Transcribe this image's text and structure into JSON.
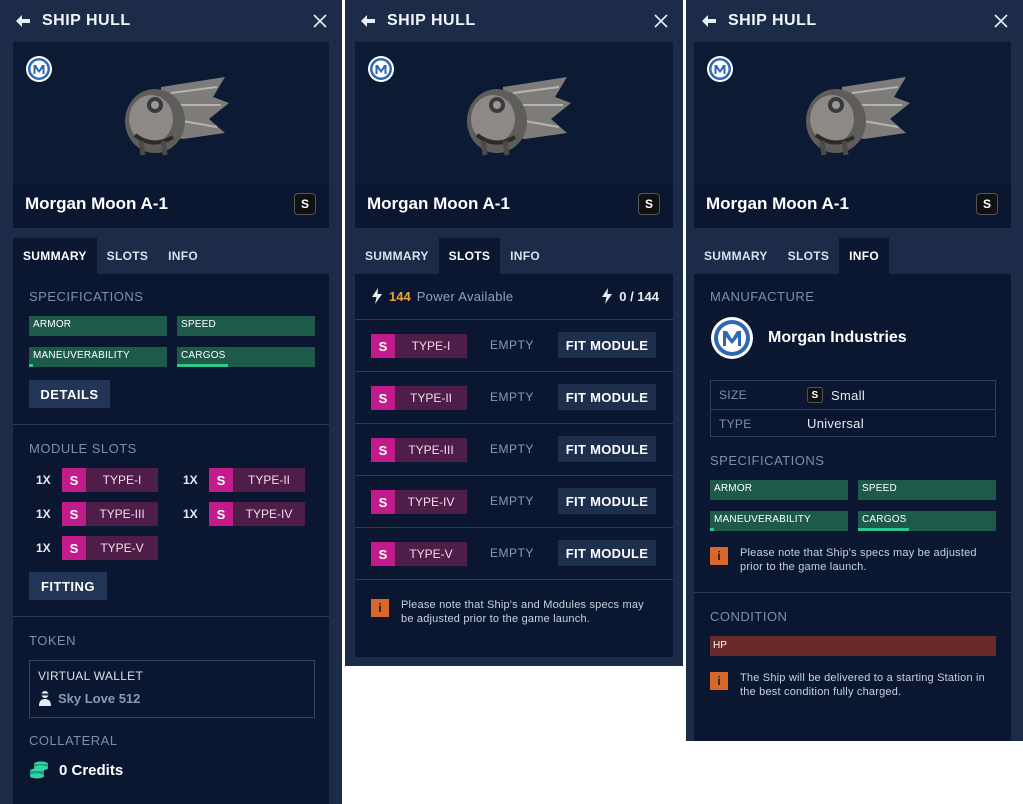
{
  "colors": {
    "panel_bg": "#1b2b48",
    "card_bg": "#0b1730",
    "stat_bg": "#1e5a4a",
    "stat_fill": "#2fc98f",
    "slot_size": "#c21c8c",
    "slot_type": "#4e1d48",
    "power_accent": "#e8a43a",
    "note_icon": "#d8672a",
    "hp_bg": "#6a2a28"
  },
  "ship": {
    "header_title": "SHIP HULL",
    "name": "Morgan Moon A-1",
    "size_badge": "S",
    "image_icon": "spaceship-hull",
    "brand_icon": "morgan-industries-logo"
  },
  "tabs": [
    "SUMMARY",
    "SLOTS",
    "INFO"
  ],
  "summary": {
    "specifications_label": "SPECIFICATIONS",
    "stats": [
      {
        "label": "ARMOR",
        "level": 0
      },
      {
        "label": "SPEED",
        "level": 0
      },
      {
        "label": "MANEUVERABILITY",
        "level": 0.03
      },
      {
        "label": "CARGOS",
        "level": 0.37
      }
    ],
    "details_button": "DETAILS",
    "module_slots_label": "MODULE SLOTS",
    "slots": [
      {
        "qty": "1X",
        "size": "S",
        "type": "TYPE-I"
      },
      {
        "qty": "1X",
        "size": "S",
        "type": "TYPE-II"
      },
      {
        "qty": "1X",
        "size": "S",
        "type": "TYPE-III"
      },
      {
        "qty": "1X",
        "size": "S",
        "type": "TYPE-IV"
      },
      {
        "qty": "1X",
        "size": "S",
        "type": "TYPE-V"
      }
    ],
    "fitting_button": "FITTING",
    "token_label": "TOKEN",
    "wallet_label": "VIRTUAL WALLET",
    "wallet_user": "Sky Love 512",
    "collateral_label": "COLLATERAL",
    "credits": "0 Credits"
  },
  "slots_tab": {
    "power_value": "144",
    "power_text": "Power Available",
    "power_usage": "0 / 144",
    "rows": [
      {
        "size": "S",
        "type": "TYPE-I",
        "status": "EMPTY",
        "action": "FIT MODULE"
      },
      {
        "size": "S",
        "type": "TYPE-II",
        "status": "EMPTY",
        "action": "FIT MODULE"
      },
      {
        "size": "S",
        "type": "TYPE-III",
        "status": "EMPTY",
        "action": "FIT MODULE"
      },
      {
        "size": "S",
        "type": "TYPE-IV",
        "status": "EMPTY",
        "action": "FIT MODULE"
      },
      {
        "size": "S",
        "type": "TYPE-V",
        "status": "EMPTY",
        "action": "FIT MODULE"
      }
    ],
    "note": "Please note that Ship's and Modules specs may be adjusted prior to the game launch."
  },
  "info_tab": {
    "manufacture_label": "MANUFACTURE",
    "manufacturer": "Morgan Industries",
    "size_key": "SIZE",
    "size_badge": "S",
    "size_value": "Small",
    "type_key": "TYPE",
    "type_value": "Universal",
    "specifications_label": "SPECIFICATIONS",
    "stats": [
      {
        "label": "ARMOR",
        "level": 0
      },
      {
        "label": "SPEED",
        "level": 0
      },
      {
        "label": "MANEUVERABILITY",
        "level": 0.03
      },
      {
        "label": "CARGOS",
        "level": 0.37
      }
    ],
    "specs_note": "Please note that Ship's specs may be adjusted prior to the game launch.",
    "condition_label": "CONDITION",
    "hp_label": "HP",
    "hp_level": 0,
    "condition_note": "The Ship will be delivered to a starting Station in the best condition fully charged."
  }
}
